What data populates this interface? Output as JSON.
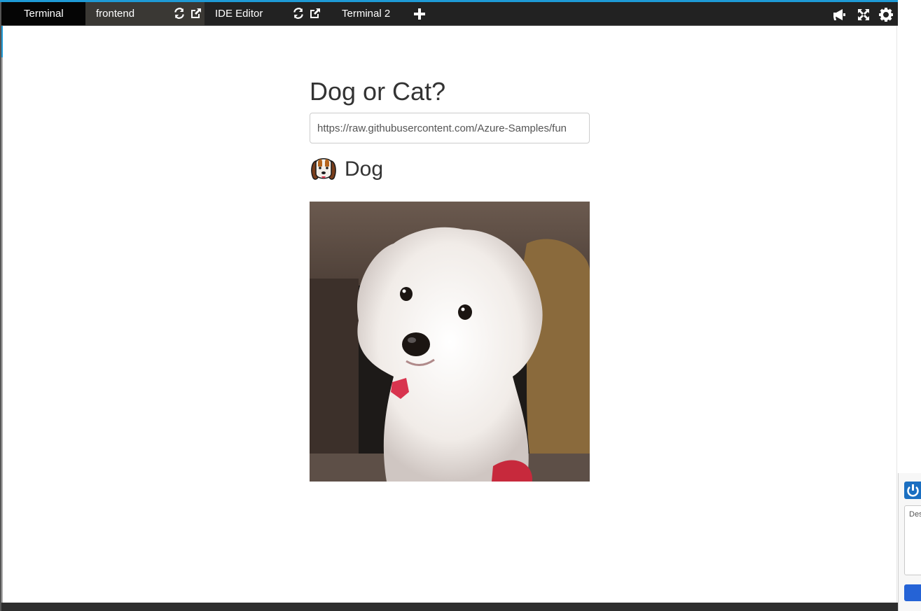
{
  "tabs": [
    {
      "label": "Terminal",
      "active": true
    },
    {
      "label": "frontend"
    },
    {
      "label": "IDE Editor"
    },
    {
      "label": "Terminal 2"
    }
  ],
  "toolbar_icons": [
    "refresh-icon",
    "external-link-icon",
    "add-tab-icon",
    "megaphone-icon",
    "fullscreen-icon",
    "gear-icon"
  ],
  "page": {
    "title": "Dog or Cat?",
    "url_value": "https://raw.githubusercontent.com/Azure-Samples/fun",
    "result_label": "Dog",
    "result_icon": "dog-face-icon",
    "photo_description": "photo of a white fluffy dog on a sofa"
  },
  "side_widget": {
    "input_placeholder": "Des"
  },
  "colors": {
    "accent": "#1e9ad6",
    "tabbar": "#222222",
    "active_tab": "#050505",
    "frontend_tab": "#3a3834",
    "title_text": "#333333",
    "side_button": "#2563d6"
  }
}
